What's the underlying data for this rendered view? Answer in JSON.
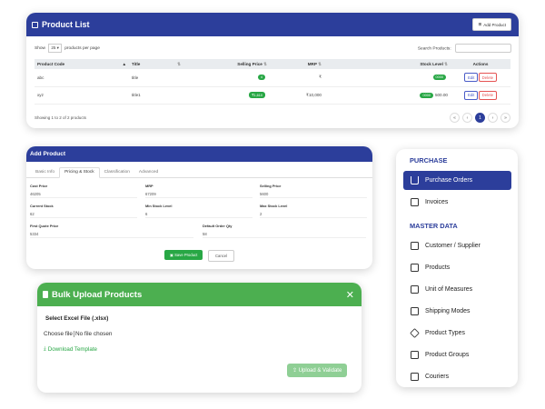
{
  "product_list": {
    "title": "Product List",
    "add_button": "Add Product",
    "show_prefix": "Show",
    "per_page": "25",
    "show_suffix": "products per page",
    "search_label": "Search Products:",
    "columns": [
      "Product Code",
      "Title",
      "Selling Price",
      "MRP",
      "Stock Level",
      "Actions"
    ],
    "rows": [
      {
        "code": "abc",
        "title": "title",
        "price_badge": "4",
        "mrp": "₹",
        "stock_badge": "0000",
        "stock_value": ""
      },
      {
        "code": "xyz",
        "title": "title1",
        "price_badge": "₹1,610",
        "mrp": "₹10,000",
        "stock_badge": "0000",
        "stock_value": "500.00"
      }
    ],
    "edit_label": "Edit",
    "delete_label": "Delete",
    "footer": "Showing 1 to 2 of 2 products",
    "pager": [
      "«",
      "‹",
      "1",
      "›",
      "»"
    ]
  },
  "add_product": {
    "title": "Add Product",
    "tabs": [
      "Basic Info",
      "Pricing & Stock",
      "Classification",
      "Advanced"
    ],
    "fields": {
      "cost_price": {
        "label": "Cost Price",
        "value": "46205"
      },
      "mrp": {
        "label": "MRP",
        "value": "67209"
      },
      "selling_price": {
        "label": "Selling Price",
        "value": "5600"
      },
      "current_stock": {
        "label": "Current Stock",
        "value": "62"
      },
      "min_stock": {
        "label": "Min Stock Level",
        "value": "6"
      },
      "max_stock": {
        "label": "Max Stock Level",
        "value": "2"
      },
      "first_quote": {
        "label": "First Quote Price",
        "value": "5334"
      },
      "default_order_qty": {
        "label": "Default Order Qty",
        "value": "58"
      }
    },
    "save_label": "Save Product",
    "cancel_label": "Cancel"
  },
  "bulk_upload": {
    "title": "Bulk Upload Products",
    "close": "✕",
    "file_label": "Select Excel File (.xlsx)",
    "choose_file": "Choose file",
    "no_file": "No file chosen",
    "download": "Download Template",
    "upload_button": "Upload & Validate"
  },
  "sidebar": {
    "section_purchase": "PURCHASE",
    "section_master": "MASTER DATA",
    "purchase_items": [
      {
        "label": "Purchase Orders",
        "icon": "cart-icon"
      },
      {
        "label": "Invoices",
        "icon": "invoice-icon"
      }
    ],
    "master_items": [
      {
        "label": "Customer / Supplier",
        "icon": "contacts-icon"
      },
      {
        "label": "Products",
        "icon": "plus-box-icon"
      },
      {
        "label": "Unit of Measures",
        "icon": "units-icon"
      },
      {
        "label": "Shipping Modes",
        "icon": "truck-icon"
      },
      {
        "label": "Product Types",
        "icon": "cube-icon"
      },
      {
        "label": "Product Groups",
        "icon": "groups-icon"
      },
      {
        "label": "Couriers",
        "icon": "courier-icon"
      }
    ]
  },
  "colors": {
    "primary": "#2c3e9b",
    "success": "#28a745",
    "upload_disabled": "#8fcf95"
  }
}
